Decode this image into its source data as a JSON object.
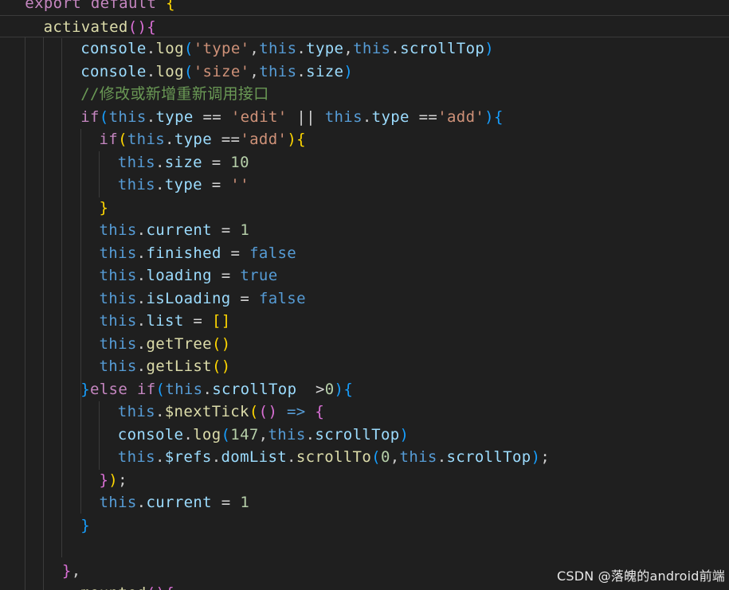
{
  "colors": {
    "kw": "#c586c0",
    "fn": "#dcdcaa",
    "prop": "#9cdcfe",
    "this": "#569cd6",
    "str": "#ce9178",
    "num": "#b5cea8",
    "comment": "#6a9955",
    "punct": "#cccccc",
    "op": "#d4d4d4",
    "b1": "#ffd700",
    "b2": "#da70d6",
    "b3": "#179fff"
  },
  "code": {
    "lines": [
      {
        "indent": 1,
        "tokens": [
          [
            "export default ",
            "kw"
          ],
          [
            "{",
            "b1"
          ]
        ]
      },
      {
        "indent": 2,
        "active": true,
        "tokens": [
          [
            "activated",
            "fn"
          ],
          [
            "()",
            "b2"
          ],
          [
            "{",
            "b2"
          ]
        ]
      },
      {
        "indent": 4,
        "tokens": [
          [
            "console",
            "prop"
          ],
          [
            ".",
            "punct"
          ],
          [
            "log",
            "fn"
          ],
          [
            "(",
            "b3"
          ],
          [
            "'type'",
            "str"
          ],
          [
            ",",
            "punct"
          ],
          [
            "this",
            "this"
          ],
          [
            ".",
            "punct"
          ],
          [
            "type",
            "prop"
          ],
          [
            ",",
            "punct"
          ],
          [
            "this",
            "this"
          ],
          [
            ".",
            "punct"
          ],
          [
            "scrollTop",
            "prop"
          ],
          [
            ")",
            "b3"
          ]
        ]
      },
      {
        "indent": 4,
        "tokens": [
          [
            "console",
            "prop"
          ],
          [
            ".",
            "punct"
          ],
          [
            "log",
            "fn"
          ],
          [
            "(",
            "b3"
          ],
          [
            "'size'",
            "str"
          ],
          [
            ",",
            "punct"
          ],
          [
            "this",
            "this"
          ],
          [
            ".",
            "punct"
          ],
          [
            "size",
            "prop"
          ],
          [
            ")",
            "b3"
          ]
        ]
      },
      {
        "indent": 4,
        "tokens": [
          [
            "//修改或新增重新调用接口",
            "comment"
          ]
        ]
      },
      {
        "indent": 4,
        "tokens": [
          [
            "if",
            "kw"
          ],
          [
            "(",
            "b3"
          ],
          [
            "this",
            "this"
          ],
          [
            ".",
            "punct"
          ],
          [
            "type",
            "prop"
          ],
          [
            " == ",
            "op"
          ],
          [
            "'edit'",
            "str"
          ],
          [
            " || ",
            "op"
          ],
          [
            "this",
            "this"
          ],
          [
            ".",
            "punct"
          ],
          [
            "type",
            "prop"
          ],
          [
            " ==",
            "op"
          ],
          [
            "'add'",
            "str"
          ],
          [
            ")",
            "b3"
          ],
          [
            "{",
            "b3"
          ]
        ]
      },
      {
        "indent": 5,
        "tokens": [
          [
            "if",
            "kw"
          ],
          [
            "(",
            "b1"
          ],
          [
            "this",
            "this"
          ],
          [
            ".",
            "punct"
          ],
          [
            "type",
            "prop"
          ],
          [
            " ==",
            "op"
          ],
          [
            "'add'",
            "str"
          ],
          [
            ")",
            "b1"
          ],
          [
            "{",
            "b1"
          ]
        ]
      },
      {
        "indent": 6,
        "tokens": [
          [
            "this",
            "this"
          ],
          [
            ".",
            "punct"
          ],
          [
            "size",
            "prop"
          ],
          [
            " = ",
            "op"
          ],
          [
            "10",
            "num"
          ]
        ]
      },
      {
        "indent": 6,
        "tokens": [
          [
            "this",
            "this"
          ],
          [
            ".",
            "punct"
          ],
          [
            "type",
            "prop"
          ],
          [
            " = ",
            "op"
          ],
          [
            "''",
            "str"
          ]
        ]
      },
      {
        "indent": 5,
        "tokens": [
          [
            "}",
            "b1"
          ]
        ]
      },
      {
        "indent": 5,
        "tokens": [
          [
            "this",
            "this"
          ],
          [
            ".",
            "punct"
          ],
          [
            "current",
            "prop"
          ],
          [
            " = ",
            "op"
          ],
          [
            "1",
            "num"
          ]
        ]
      },
      {
        "indent": 5,
        "tokens": [
          [
            "this",
            "this"
          ],
          [
            ".",
            "punct"
          ],
          [
            "finished",
            "prop"
          ],
          [
            " = ",
            "op"
          ],
          [
            "false",
            "this"
          ]
        ]
      },
      {
        "indent": 5,
        "tokens": [
          [
            "this",
            "this"
          ],
          [
            ".",
            "punct"
          ],
          [
            "loading",
            "prop"
          ],
          [
            " = ",
            "op"
          ],
          [
            "true",
            "this"
          ]
        ]
      },
      {
        "indent": 5,
        "tokens": [
          [
            "this",
            "this"
          ],
          [
            ".",
            "punct"
          ],
          [
            "isLoading",
            "prop"
          ],
          [
            " = ",
            "op"
          ],
          [
            "false",
            "this"
          ]
        ]
      },
      {
        "indent": 5,
        "tokens": [
          [
            "this",
            "this"
          ],
          [
            ".",
            "punct"
          ],
          [
            "list",
            "prop"
          ],
          [
            " = ",
            "op"
          ],
          [
            "[]",
            "b1"
          ]
        ]
      },
      {
        "indent": 5,
        "tokens": [
          [
            "this",
            "this"
          ],
          [
            ".",
            "punct"
          ],
          [
            "getTree",
            "fn"
          ],
          [
            "()",
            "b1"
          ]
        ]
      },
      {
        "indent": 5,
        "tokens": [
          [
            "this",
            "this"
          ],
          [
            ".",
            "punct"
          ],
          [
            "getList",
            "fn"
          ],
          [
            "()",
            "b1"
          ]
        ]
      },
      {
        "indent": 4,
        "tokens": [
          [
            "}",
            "b3"
          ],
          [
            "else ",
            "kw"
          ],
          [
            "if",
            "kw"
          ],
          [
            "(",
            "b3"
          ],
          [
            "this",
            "this"
          ],
          [
            ".",
            "punct"
          ],
          [
            "scrollTop",
            "prop"
          ],
          [
            "  >",
            "op"
          ],
          [
            "0",
            "num"
          ],
          [
            ")",
            "b3"
          ],
          [
            "{",
            "b3"
          ]
        ]
      },
      {
        "indent": 6,
        "tokens": [
          [
            "this",
            "this"
          ],
          [
            ".",
            "punct"
          ],
          [
            "$nextTick",
            "fn"
          ],
          [
            "(",
            "b1"
          ],
          [
            "()",
            "b2"
          ],
          [
            " => ",
            "this"
          ],
          [
            "{",
            "b2"
          ]
        ]
      },
      {
        "indent": 6,
        "tokens": [
          [
            "console",
            "prop"
          ],
          [
            ".",
            "punct"
          ],
          [
            "log",
            "fn"
          ],
          [
            "(",
            "b3"
          ],
          [
            "147",
            "num"
          ],
          [
            ",",
            "punct"
          ],
          [
            "this",
            "this"
          ],
          [
            ".",
            "punct"
          ],
          [
            "scrollTop",
            "prop"
          ],
          [
            ")",
            "b3"
          ]
        ]
      },
      {
        "indent": 6,
        "tokens": [
          [
            "this",
            "this"
          ],
          [
            ".",
            "punct"
          ],
          [
            "$refs",
            "prop"
          ],
          [
            ".",
            "punct"
          ],
          [
            "domList",
            "prop"
          ],
          [
            ".",
            "punct"
          ],
          [
            "scrollTo",
            "fn"
          ],
          [
            "(",
            "b3"
          ],
          [
            "0",
            "num"
          ],
          [
            ",",
            "punct"
          ],
          [
            "this",
            "this"
          ],
          [
            ".",
            "punct"
          ],
          [
            "scrollTop",
            "prop"
          ],
          [
            ")",
            "b3"
          ],
          [
            ";",
            "punct"
          ]
        ]
      },
      {
        "indent": 5,
        "tokens": [
          [
            "}",
            "b2"
          ],
          [
            ")",
            "b1"
          ],
          [
            ";",
            "punct"
          ]
        ]
      },
      {
        "indent": 5,
        "tokens": [
          [
            "this",
            "this"
          ],
          [
            ".",
            "punct"
          ],
          [
            "current",
            "prop"
          ],
          [
            " = ",
            "op"
          ],
          [
            "1",
            "num"
          ]
        ]
      },
      {
        "indent": 4,
        "tokens": [
          [
            "}",
            "b3"
          ]
        ]
      },
      {
        "indent": 0,
        "tokens": []
      },
      {
        "indent": 3,
        "tokens": [
          [
            "}",
            "b2"
          ],
          [
            ",",
            "punct"
          ]
        ]
      },
      {
        "indent": 4,
        "tokens": [
          [
            "mounted",
            "fn"
          ],
          [
            "()",
            "b2"
          ],
          [
            "{",
            "b2"
          ]
        ]
      }
    ]
  },
  "watermark": "CSDN @落魄的android前端"
}
